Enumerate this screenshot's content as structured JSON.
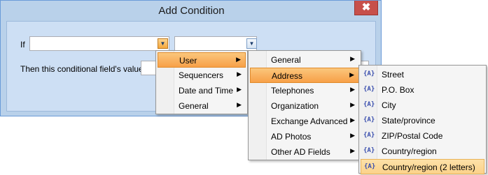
{
  "dialog": {
    "title": "Add Condition",
    "close_glyph": "✖",
    "if_label": "If",
    "then_label": "Then this conditional field's value is"
  },
  "icons": {
    "dropdown": "▼",
    "submenu_arrow": "▶",
    "field": "{A}"
  },
  "menu1": {
    "items": [
      {
        "label": "User"
      },
      {
        "label": "Sequencers"
      },
      {
        "label": "Date and Time"
      },
      {
        "label": "General"
      }
    ]
  },
  "menu2": {
    "items": [
      {
        "label": "General"
      },
      {
        "label": "Address"
      },
      {
        "label": "Telephones"
      },
      {
        "label": "Organization"
      },
      {
        "label": "Exchange Advanced"
      },
      {
        "label": "AD Photos"
      },
      {
        "label": "Other AD Fields"
      }
    ]
  },
  "menu3": {
    "items": [
      {
        "label": "Street"
      },
      {
        "label": "P.O. Box"
      },
      {
        "label": "City"
      },
      {
        "label": "State/province"
      },
      {
        "label": "ZIP/Postal Code"
      },
      {
        "label": "Country/region"
      },
      {
        "label": "Country/region (2 letters)"
      }
    ]
  }
}
